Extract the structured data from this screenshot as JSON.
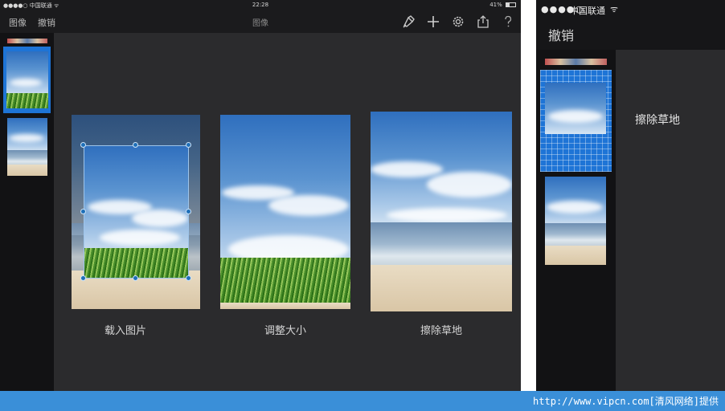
{
  "ipad": {
    "status": {
      "carrier": "●●●●○ 中国联通 ᯤ",
      "time": "22:28",
      "battery": "41%"
    },
    "toolbar": {
      "left_items": [
        "图像",
        "撤销"
      ],
      "title": "图像",
      "icons": [
        "brush-icon",
        "plus-icon",
        "gear-icon",
        "share-icon",
        "help-icon"
      ]
    },
    "captions": [
      "载入图片",
      "调整大小",
      "擦除草地"
    ]
  },
  "iphone": {
    "status": {
      "signal": "●●●●○",
      "carrier": "中国联通",
      "wifi": "ᯤ"
    },
    "nav": {
      "undo": "撤销"
    },
    "selected_label": "擦除草地"
  },
  "footer": {
    "watermark": "http://www.vipcn.com[清风网络]提供"
  },
  "colors": {
    "accent": "#1e74d6",
    "footer": "#3a8fd8",
    "panel_bg": "#2b2b2d",
    "sidebar_bg": "#121214"
  }
}
